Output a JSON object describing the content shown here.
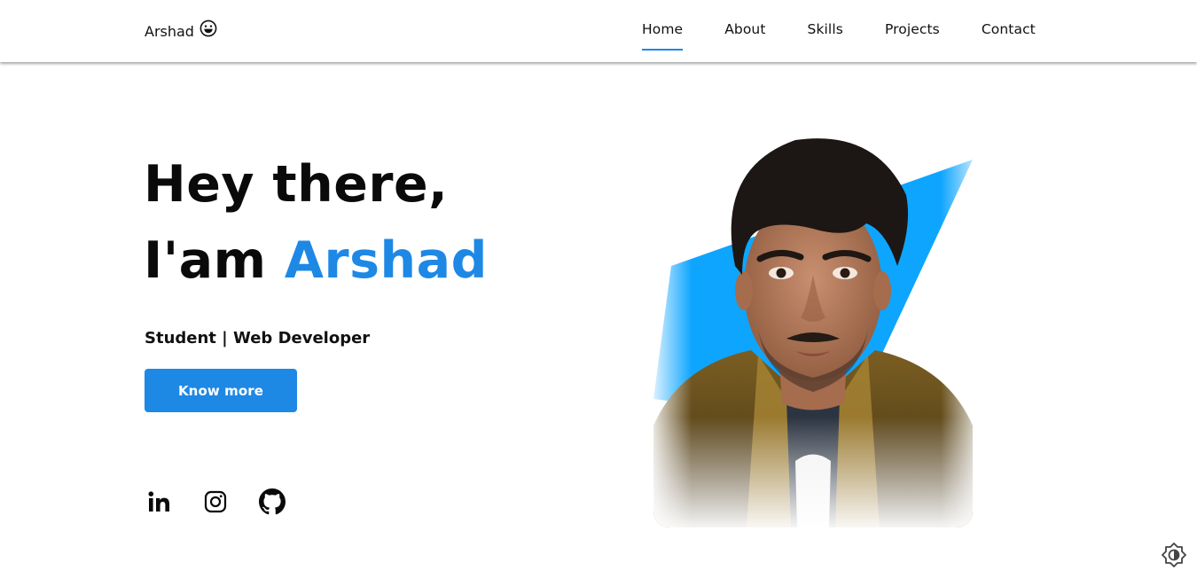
{
  "nav": {
    "brand": "Arshad",
    "brand_icon": "grinning-face-icon",
    "links": [
      "Home",
      "About",
      "Skills",
      "Projects",
      "Contact"
    ],
    "active": "Home"
  },
  "hero": {
    "line1": "Hey there,",
    "line2_prefix": "I'am",
    "name": "Arshad",
    "subtitle": "Student | Web Developer",
    "cta_label": "Know more"
  },
  "socials": [
    "linkedin-icon",
    "instagram-icon",
    "github-icon"
  ],
  "theme_toggle_icon": "brightness-toggle-icon",
  "colors": {
    "accent": "#1e88e5",
    "backdrop": "#0ea5ff",
    "text": "#0a0a0a"
  }
}
